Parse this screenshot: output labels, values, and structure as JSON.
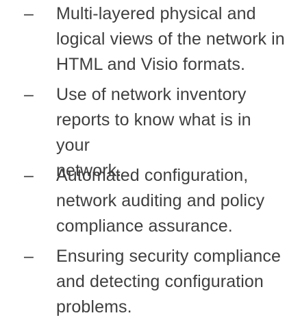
{
  "features": {
    "bullet": "–",
    "items": [
      {
        "lines": [
          "Multi-layered physical and",
          "logical views of the network in",
          "HTML and Visio formats."
        ]
      },
      {
        "lines": [
          "Use of network inventory",
          "reports to know what is in your",
          "network."
        ]
      },
      {
        "lines": [
          "Automated configuration,",
          "network auditing and policy",
          "compliance assurance."
        ]
      },
      {
        "lines": [
          "Ensuring security compliance",
          "and detecting configuration",
          "problems."
        ]
      }
    ]
  }
}
